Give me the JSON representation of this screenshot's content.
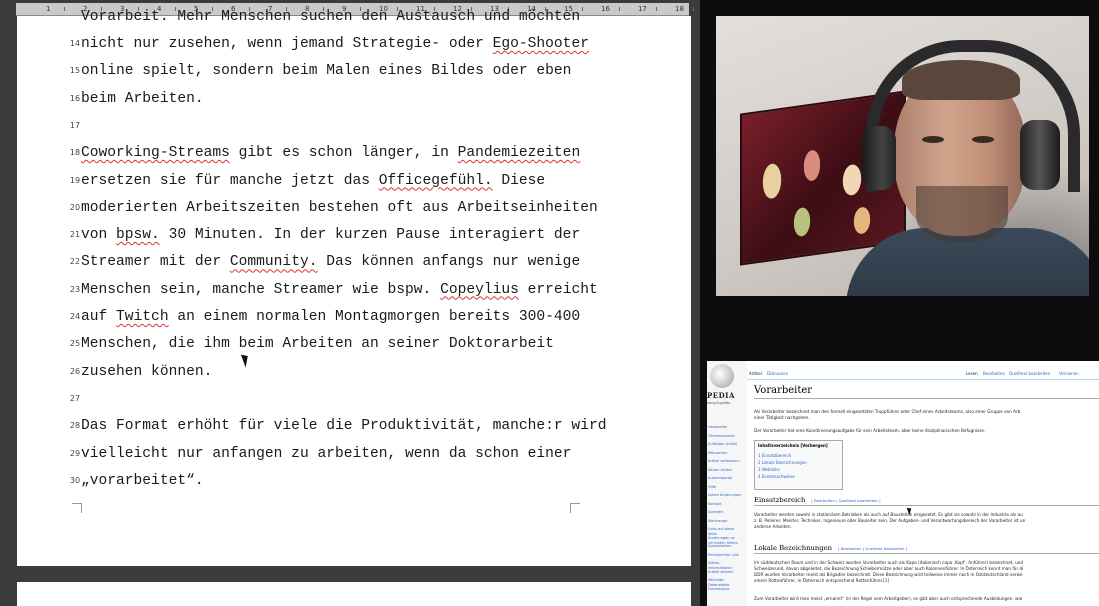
{
  "document": {
    "ruler_numbers": [
      "1",
      "2",
      "3",
      "4",
      "5",
      "6",
      "7",
      "8",
      "9",
      "10",
      "11",
      "12",
      "13",
      "14",
      "15",
      "16",
      "17",
      "18"
    ],
    "top_partial_text": "Vorarbeit. Mehr Menschen suchen den Austausch und möchten",
    "lines": [
      {
        "num": "14",
        "segments": [
          {
            "t": "nicht nur zusehen, wenn jemand Strategie- oder "
          },
          {
            "t": "Ego-Shooter",
            "spell": true
          }
        ]
      },
      {
        "num": "15",
        "segments": [
          {
            "t": "online spielt, sondern beim Malen eines Bildes oder eben"
          }
        ]
      },
      {
        "num": "16",
        "segments": [
          {
            "t": "beim Arbeiten."
          }
        ]
      },
      {
        "num": "17",
        "segments": []
      },
      {
        "num": "18",
        "segments": [
          {
            "t": "Coworking-Streams",
            "spell": true
          },
          {
            "t": " gibt es schon länger, in "
          },
          {
            "t": "Pandemiezeiten",
            "spell": true
          }
        ]
      },
      {
        "num": "19",
        "segments": [
          {
            "t": "ersetzen sie für manche jetzt das "
          },
          {
            "t": "Officegefühl.",
            "spell": true
          },
          {
            "t": " Diese"
          }
        ]
      },
      {
        "num": "20",
        "segments": [
          {
            "t": "moderierten Arbeitszeiten bestehen oft aus Arbeitseinheiten"
          }
        ]
      },
      {
        "num": "21",
        "segments": [
          {
            "t": "von "
          },
          {
            "t": "bpsw.",
            "spell": true
          },
          {
            "t": " 30 Minuten. In der kurzen Pause interagiert der"
          }
        ]
      },
      {
        "num": "22",
        "segments": [
          {
            "t": "Streamer mit der "
          },
          {
            "t": "Community.",
            "spell": true
          },
          {
            "t": " Das können anfangs nur wenige"
          }
        ]
      },
      {
        "num": "23",
        "segments": [
          {
            "t": "Menschen sein, manche Streamer wie bspw. "
          },
          {
            "t": "Copeylius",
            "spell": true
          },
          {
            "t": " erreicht"
          }
        ]
      },
      {
        "num": "24",
        "segments": [
          {
            "t": "auf "
          },
          {
            "t": "Twitch",
            "spell": true
          },
          {
            "t": " an einem normalen Montagmorgen bereits 300-400"
          }
        ]
      },
      {
        "num": "25",
        "segments": [
          {
            "t": "Menschen, die ihm beim Arbeiten an seiner Doktorarbeit"
          }
        ]
      },
      {
        "num": "26",
        "segments": [
          {
            "t": "zusehen können."
          }
        ]
      },
      {
        "num": "27",
        "segments": []
      },
      {
        "num": "28",
        "segments": [
          {
            "t": "Das Format erhöht für viele die Produktivität, manche:r wird"
          }
        ]
      },
      {
        "num": "29",
        "segments": [
          {
            "t": "vielleicht nur anfangen zu arbeiten, wenn da schon einer"
          }
        ]
      },
      {
        "num": "30",
        "segments": [
          {
            "t": "„vorarbeitet“."
          }
        ]
      }
    ]
  },
  "webcam": {
    "description_icon": "person-with-headphones"
  },
  "wikipedia": {
    "logo_text": "PEDIA",
    "logo_sub": "encyclopedia",
    "tabs_left": [
      "Artikel",
      "Diskussion"
    ],
    "tabs_right": [
      "Lesen",
      "Bearbeiten",
      "Quelltext bearbeiten",
      "Versionen"
    ],
    "title": "Vorarbeiter",
    "intro": "Als Vorarbeiter bezeichnet man den formell eingesetzten Truppführer oder Chef eines Arbeitsteams, also einer Gruppe von Arb",
    "intro2": "einer Tätigkeit nachgehen.",
    "intro3": "Der Vorarbeiter hat eine Koordinierungsaufgabe für sein Arbeitsteam, aber keine disziplinarischen Befugnisse.",
    "toc_title": "Inhaltsverzeichnis [Verbergen]",
    "toc_items": [
      "1 Einsatzbereich",
      "2 Lokale Bezeichnungen",
      "3 Weblinks",
      "4 Einzelnachweise"
    ],
    "h_einsatz": "Einsatzbereich",
    "h_edit": "[ Bearbeiten | Quelltext bearbeiten ]",
    "einsatz_1": "Vorarbeiter werden sowohl in stationären Betrieben als auch auf Baustellen eingesetzt. Es gibt sie sowohl in der Industrie als au",
    "einsatz_2": "z. B. Polierer, Meister, Techniker, Ingenieure oder Bauleiter sein. Der Aufgaben- und Verantwortungsbereich der Vorarbeiter ist un",
    "einsatz_3": "anderen Arbeiten.",
    "h_lokal": "Lokale Bezeichnungen",
    "lokal_1": "Im süddeutschen Raum und in der Schweiz werden Vorarbeiter auch als Kapo (italienisch capo ‚Kopf‘, Anführer) bezeichnet, und",
    "lokal_2": "Schweizerund, davon abgeleitet, die Bezeichnung Schiebermütze oder aber auch Kolonnenführer. In Österreich kennt man für di",
    "lokal_3": "DDR wurden Vorarbeiter meist als Brigadier bezeichnet. Diese Bezeichnung wird teilweise immer noch in Ostdeutschland verwe",
    "lokal_4": "einem Rottenführer, in Österreich entsprechend Rottenführer.[1]",
    "lokal_5": "Zum Vorarbeiter wird man meist „ernannt“ (in der Regel vom Arbeitgeber), es gibt aber auch entsprechende Ausbildungen, wie",
    "side_links": [
      "Hauptseite",
      "Themenportale",
      "Zufälliger Artikel",
      "Mitmachen",
      "Artikel verbessern",
      "Neuen Artikel",
      "Autorenportal",
      "Hilfe",
      "Letzte Änderungen",
      "Kontakt",
      "Spenden",
      "Werkzeuge",
      "Links auf diese Seite",
      "Änderungen an verlinkten Seiten",
      "Spezialseiten",
      "Permanenter Link",
      "Seiten-informationen",
      "Artikel zitieren",
      "Wikidata-Datenobjekt",
      "Druckexport"
    ]
  }
}
